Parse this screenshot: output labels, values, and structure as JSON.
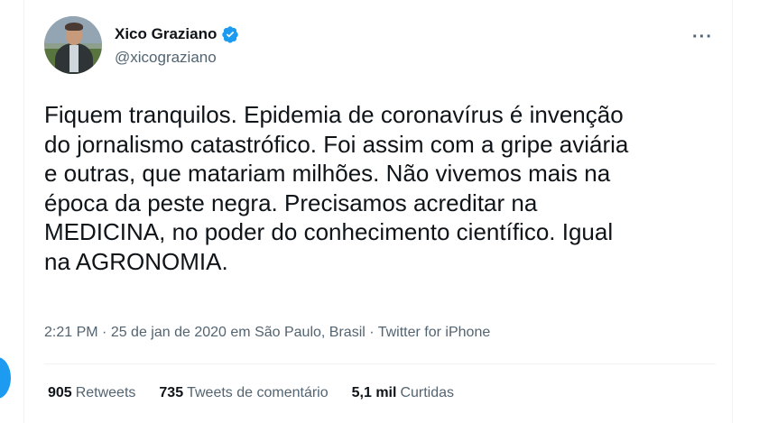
{
  "author": {
    "name": "Xico Graziano",
    "handle": "@xicograziano",
    "verified_icon": "verified-badge-icon"
  },
  "more_label": "···",
  "tweet": {
    "text": "Fiquem tranquilos. Epidemia de coronavírus é invenção\ndo jornalismo catastrófico. Foi assim com a gripe aviária\ne outras, que matariam milhões. Não vivemos mais na\népoca da peste negra. Precisamos acreditar na\nMEDICINA, no poder do conhecimento científico. Igual\nna AGRONOMIA."
  },
  "meta": {
    "time": "2:21 PM",
    "sep1": " · ",
    "date": "25 de jan de 2020",
    "location_prefix": " em ",
    "location": "São Paulo, Brasil",
    "sep2": " · ",
    "source": "Twitter for iPhone"
  },
  "stats": {
    "retweets_count": "905",
    "retweets_label": "Retweets",
    "quotes_count": "735",
    "quotes_label": "Tweets de comentário",
    "likes_count": "5,1 mil",
    "likes_label": "Curtidas"
  },
  "colors": {
    "accent": "#1d9bf0",
    "text_primary": "#0f1419",
    "text_secondary": "#536471",
    "divider": "#eff3f4"
  }
}
